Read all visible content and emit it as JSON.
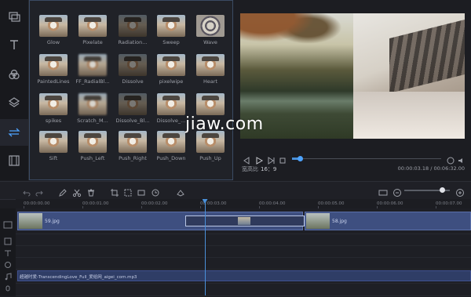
{
  "toolbar": {
    "items": [
      {
        "icon": "layers-icon"
      },
      {
        "icon": "text-icon"
      },
      {
        "icon": "filter-icon"
      },
      {
        "icon": "overlay-icon"
      },
      {
        "icon": "transition-icon",
        "active": true
      },
      {
        "icon": "film-icon"
      }
    ]
  },
  "transitions": {
    "items": [
      {
        "label": "Glow"
      },
      {
        "label": "Pixelate"
      },
      {
        "label": "Radiation..."
      },
      {
        "label": "Sweep"
      },
      {
        "label": "Wave"
      },
      {
        "label": "PaintedLines"
      },
      {
        "label": "FF_RadialBl..."
      },
      {
        "label": "Dissolve"
      },
      {
        "label": "pixelwipe"
      },
      {
        "label": "Heart"
      },
      {
        "label": "spikes"
      },
      {
        "label": "Scratch_M..."
      },
      {
        "label": "Dissolve_Bl..."
      },
      {
        "label": "Dissolve_..."
      },
      {
        "label": ""
      },
      {
        "label": "Sift"
      },
      {
        "label": "Push_Left"
      },
      {
        "label": "Push_Right"
      },
      {
        "label": "Push_Down"
      },
      {
        "label": "Push_Up"
      }
    ]
  },
  "player": {
    "aspect_label": "宽高比",
    "aspect_value": "16：9",
    "current_time": "00:00:03.18",
    "total_time": "00:06:32.00",
    "progress_fraction": 0.05
  },
  "timeline": {
    "ruler": [
      "00:00:00.00",
      "00:00:01.00",
      "00:00:02.00",
      "00:00:03.00",
      "00:00:04.00",
      "00:00:05.00",
      "00:00:06.00",
      "00:00:07.00"
    ],
    "zoom_fraction": 0.82,
    "clips": [
      {
        "label": "59.jpg"
      },
      {
        "label": "58.jpg"
      }
    ],
    "audio_label": "超越时爱-TranscendingLove_Full_爱给网_aigei_com.mp3"
  },
  "watermark": "jiaw.com"
}
